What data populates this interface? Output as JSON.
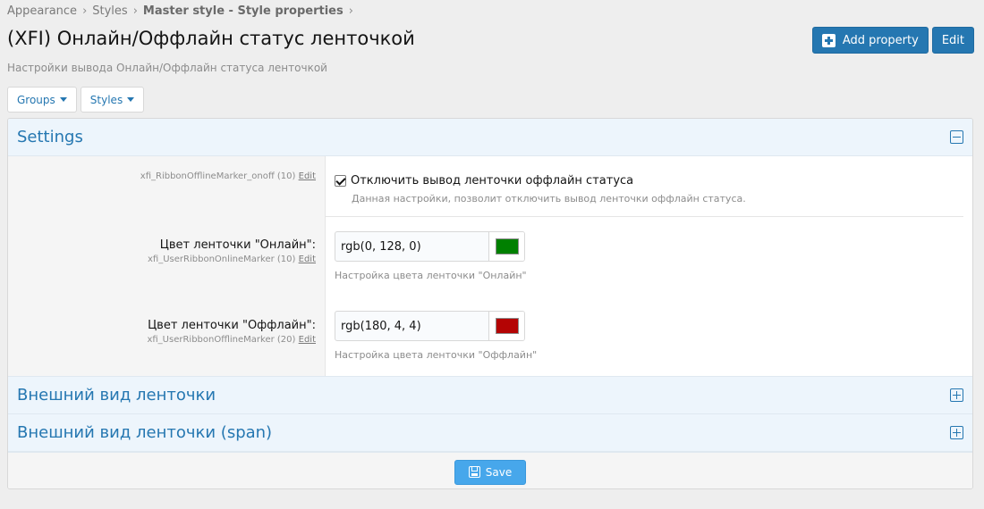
{
  "breadcrumb": [
    "Appearance",
    "Styles",
    "Master style - Style properties"
  ],
  "page": {
    "title": "(XFI) Онлайн/Оффлайн статус ленточкой",
    "subtitle": "Настройки вывода Онлайн/Оффлайн статуса ленточкой"
  },
  "actions": {
    "add_property": "Add property",
    "edit": "Edit"
  },
  "filters": {
    "groups": "Groups",
    "styles": "Styles"
  },
  "settings": {
    "title": "Settings",
    "rows": [
      {
        "meta": "xfi_RibbonOfflineMarker_onoff (10)",
        "edit": "Edit",
        "checkbox_label": "Отключить вывод ленточки оффлайн статуса",
        "checked": true,
        "hint": "Данная настройки, позволит отключить вывод ленточки оффлайн статуса."
      },
      {
        "label": "Цвет ленточки \"Онлайн\":",
        "meta": "xfi_UserRibbonOnlineMarker (10)",
        "edit": "Edit",
        "value": "rgb(0, 128, 0)",
        "swatch": "#008000",
        "hint": "Настройка цвета ленточки \"Онлайн\""
      },
      {
        "label": "Цвет ленточки \"Оффлайн\":",
        "meta": "xfi_UserRibbonOfflineMarker (20)",
        "edit": "Edit",
        "value": "rgb(180, 4, 4)",
        "swatch": "#b40404",
        "hint": "Настройка цвета ленточки \"Оффлайн\""
      }
    ]
  },
  "sections": [
    {
      "title": "Внешний вид ленточки"
    },
    {
      "title": "Внешний вид ленточки (span)"
    }
  ],
  "footer": {
    "save": "Save"
  }
}
